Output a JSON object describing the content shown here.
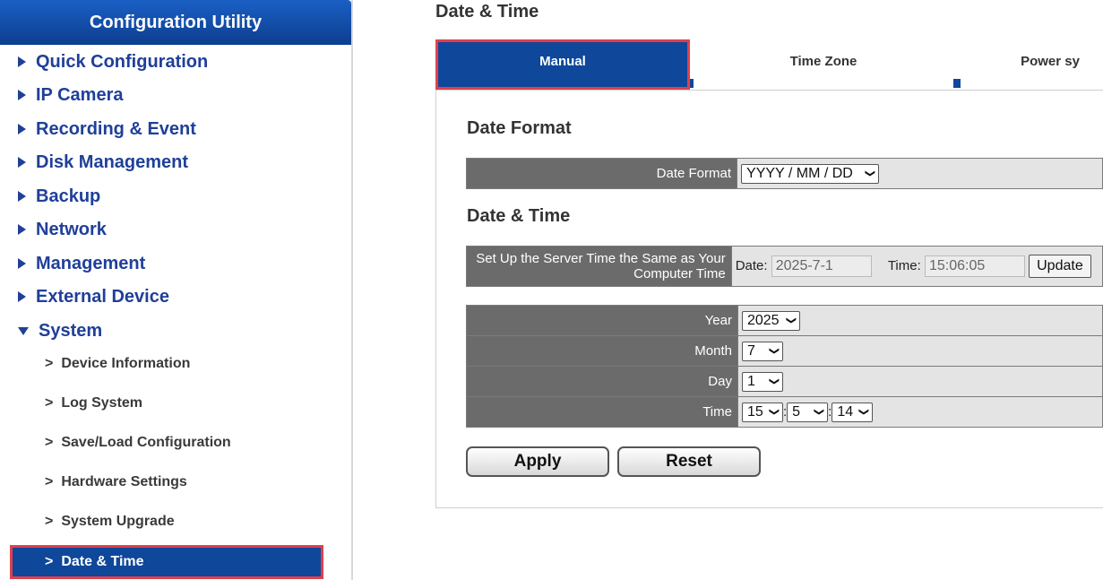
{
  "sidebar": {
    "title": "Configuration Utility",
    "items": [
      {
        "label": "Quick Configuration"
      },
      {
        "label": "IP Camera"
      },
      {
        "label": "Recording & Event"
      },
      {
        "label": "Disk Management"
      },
      {
        "label": "Backup"
      },
      {
        "label": "Network"
      },
      {
        "label": "Management"
      },
      {
        "label": "External Device"
      },
      {
        "label": "System"
      }
    ],
    "sub_items": [
      {
        "label": "Device Information"
      },
      {
        "label": "Log System"
      },
      {
        "label": "Save/Load Configuration"
      },
      {
        "label": "Hardware Settings"
      },
      {
        "label": "System Upgrade"
      },
      {
        "label": "Date & Time"
      }
    ],
    "sub_prefix": ">"
  },
  "page": {
    "title": "Date & Time",
    "tabs": [
      {
        "label": "Manual"
      },
      {
        "label": "Time Zone"
      },
      {
        "label": "Power sy"
      }
    ]
  },
  "date_format": {
    "section_title": "Date Format",
    "label": "Date Format",
    "value": "YYYY / MM / DD"
  },
  "date_time": {
    "section_title": "Date & Time",
    "sync_label_line1": "Set Up the Server Time the Same as Your",
    "sync_label_line2": "Computer Time",
    "date_label": "Date:",
    "date_value": "2025-7-1",
    "time_label": "Time:",
    "time_value": "15:06:05",
    "update_label": "Update",
    "year_label": "Year",
    "year_value": "2025",
    "month_label": "Month",
    "month_value": "7",
    "day_label": "Day",
    "day_value": "1",
    "time_row_label": "Time",
    "hour_value": "15",
    "minute_value": "5",
    "second_value": "14",
    "separator": ":"
  },
  "actions": {
    "apply": "Apply",
    "reset": "Reset"
  },
  "colors": {
    "brand_blue": "#0f479b",
    "menu_text": "#1f3f99",
    "highlight_red": "#e0404a"
  }
}
